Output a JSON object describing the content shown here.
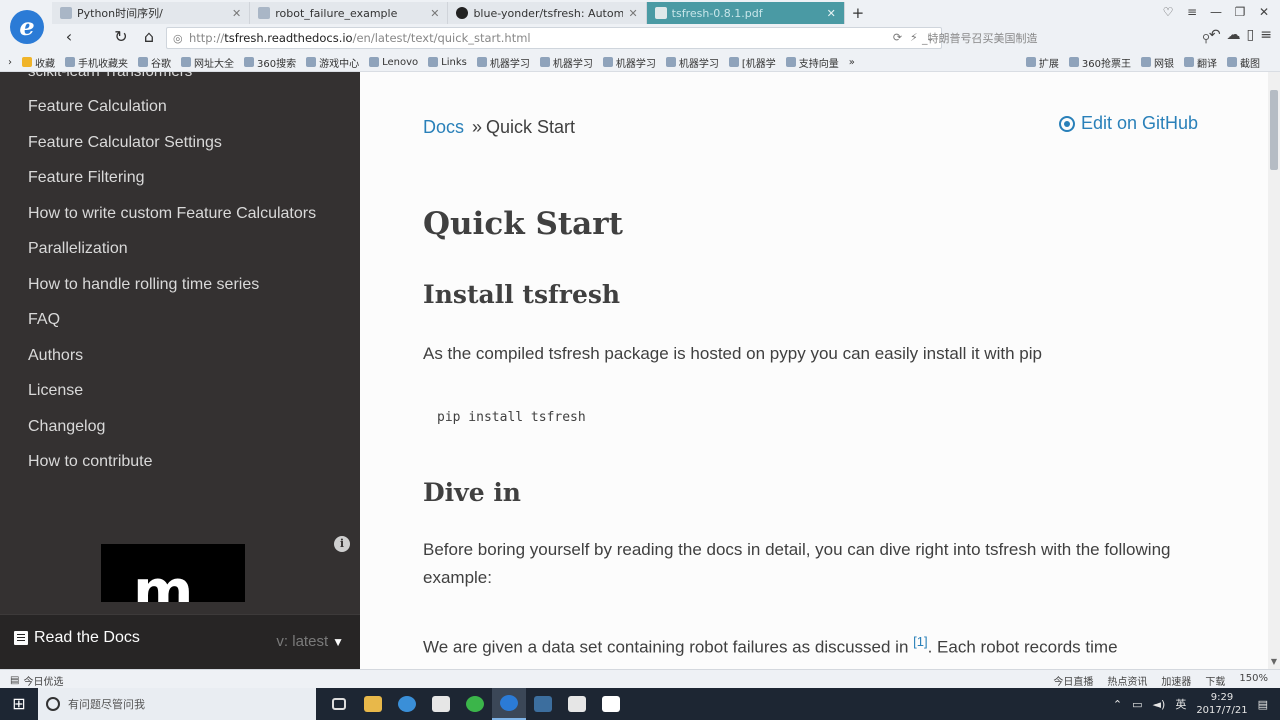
{
  "browser": {
    "tabs": [
      {
        "label": "Python时间序列/",
        "active": false
      },
      {
        "label": "robot_failure_example",
        "active": false
      },
      {
        "label": "blue-yonder/tsfresh: Automati",
        "active": false
      },
      {
        "label": "tsfresh-0.8.1.pdf",
        "active": true
      }
    ],
    "new_tab": "+",
    "url_prefix": "http://",
    "url_host": "tsfresh.readthedocs.io",
    "url_path": "/en/latest/text/quick_start.html",
    "search_placeholder": "_特朗普号召买美国制造",
    "bookmarks": [
      "收藏",
      "手机收藏夹",
      "谷歌",
      "网址大全",
      "360搜索",
      "游戏中心",
      "Lenovo",
      "Links",
      "机器学习",
      "机器学习",
      "机器学习",
      "机器学习",
      "[机器学",
      "支持向量"
    ],
    "bookmarks_right": [
      "扩展",
      "360抢票王",
      "网银",
      "翻译",
      "截图"
    ],
    "status_left": "今日优选",
    "status_right": [
      "今日直播",
      "热点资讯",
      "加速器",
      "下载",
      "150%"
    ]
  },
  "sidebar": {
    "clipped_item": "scikit-learn Transformers",
    "items": [
      "Feature Calculation",
      "Feature Calculator Settings",
      "Feature Filtering",
      "How to write custom Feature Calculators",
      "Parallelization",
      "How to handle rolling time series",
      "FAQ",
      "Authors",
      "License",
      "Changelog",
      "How to contribute"
    ],
    "ad_logo": "m",
    "rtd_label": "Read the Docs",
    "rtd_version": "v: latest"
  },
  "main": {
    "breadcrumb_root": "Docs",
    "breadcrumb_sep": "»",
    "breadcrumb_current": "Quick Start",
    "edit_link": "Edit on GitHub",
    "title": "Quick Start",
    "install_heading": "Install tsfresh",
    "install_text": "As the compiled tsfresh package is hosted on pypy you can easily install it with pip",
    "install_code": "pip install tsfresh",
    "dive_heading": "Dive in",
    "dive_text": "Before boring yourself by reading the docs in detail, you can dive right into tsfresh with the following example:",
    "given_text_a": "We are given a data set containing robot failures as discussed in ",
    "given_ref": "[1]",
    "given_text_b": ". Each robot records time"
  },
  "taskbar": {
    "search_placeholder": "有问题尽管问我",
    "time": "9:29",
    "date": "2017/7/21",
    "ime": "英"
  }
}
